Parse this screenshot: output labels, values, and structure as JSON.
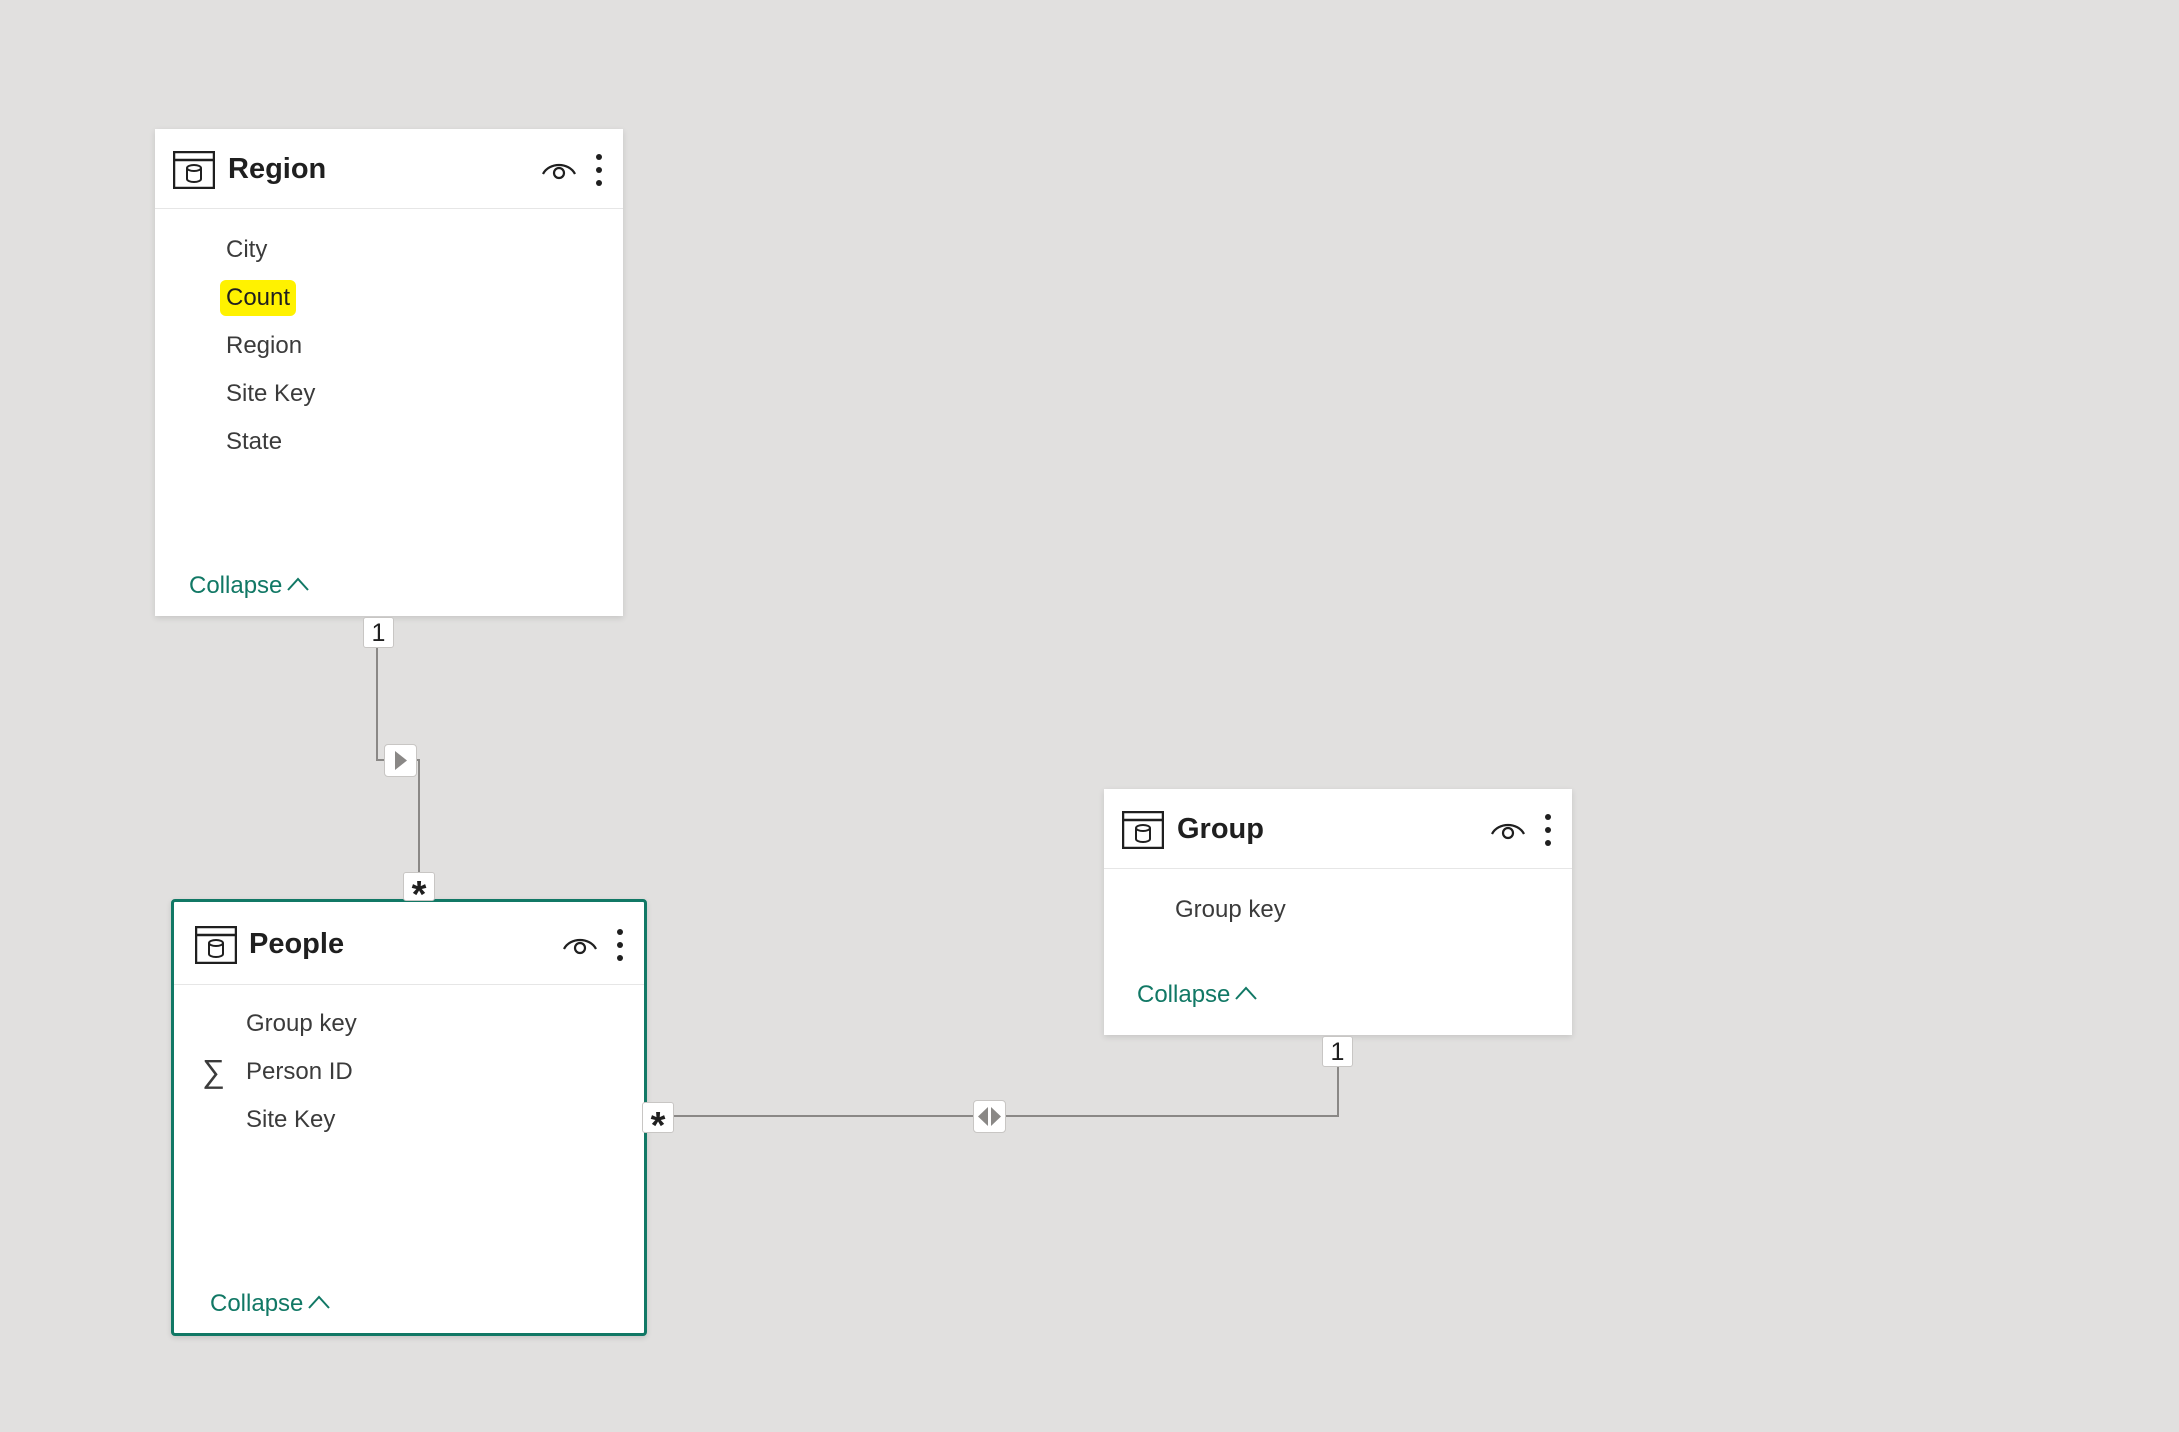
{
  "colors": {
    "canvas_bg": "#e1e0df",
    "accent": "#117865",
    "highlight": "#fff200",
    "line": "#8a8886"
  },
  "tables": {
    "region": {
      "title": "Region",
      "fields": [
        "City",
        "Count",
        "Region",
        "Site Key",
        "State"
      ],
      "highlighted_field": "Count",
      "collapse_label": "Collapse"
    },
    "people": {
      "title": "People",
      "fields": [
        "Group key",
        "Person ID",
        "Site Key"
      ],
      "measure_field": "Person ID",
      "selected": true,
      "collapse_label": "Collapse"
    },
    "group": {
      "title": "Group",
      "fields": [
        "Group key"
      ],
      "collapse_label": "Collapse"
    }
  },
  "relationships": [
    {
      "from": "Region",
      "to": "People",
      "from_cardinality": "1",
      "to_cardinality": "*",
      "filter_direction": "single"
    },
    {
      "from": "Group",
      "to": "People",
      "from_cardinality": "1",
      "to_cardinality": "*",
      "filter_direction": "both"
    }
  ],
  "icons": {
    "table": "table-icon",
    "visibility": "eye-icon",
    "more": "more-options-icon",
    "collapse": "chevron-up-icon",
    "measure": "sigma-icon"
  }
}
